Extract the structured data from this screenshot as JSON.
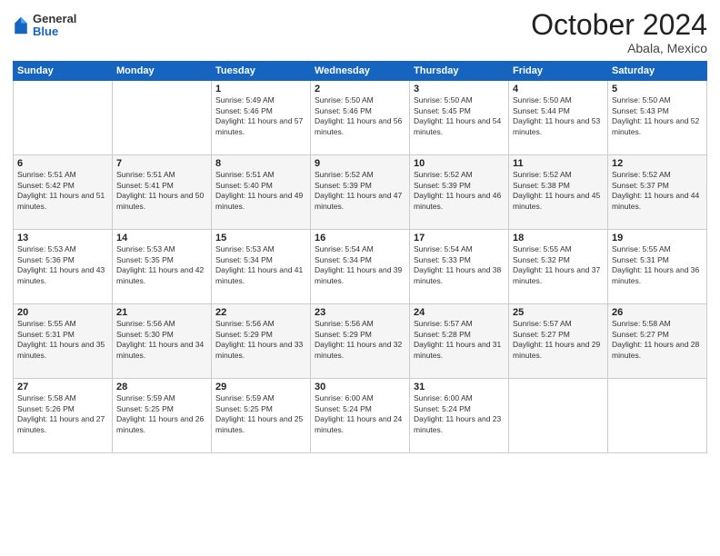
{
  "header": {
    "logo": {
      "general": "General",
      "blue": "Blue"
    },
    "title": "October 2024",
    "location": "Abala, Mexico"
  },
  "weekdays": [
    "Sunday",
    "Monday",
    "Tuesday",
    "Wednesday",
    "Thursday",
    "Friday",
    "Saturday"
  ],
  "weeks": [
    [
      {
        "day": null
      },
      {
        "day": null
      },
      {
        "day": "1",
        "sunrise": "5:49 AM",
        "sunset": "5:46 PM",
        "daylight": "11 hours and 57 minutes."
      },
      {
        "day": "2",
        "sunrise": "5:50 AM",
        "sunset": "5:46 PM",
        "daylight": "11 hours and 56 minutes."
      },
      {
        "day": "3",
        "sunrise": "5:50 AM",
        "sunset": "5:45 PM",
        "daylight": "11 hours and 54 minutes."
      },
      {
        "day": "4",
        "sunrise": "5:50 AM",
        "sunset": "5:44 PM",
        "daylight": "11 hours and 53 minutes."
      },
      {
        "day": "5",
        "sunrise": "5:50 AM",
        "sunset": "5:43 PM",
        "daylight": "11 hours and 52 minutes."
      }
    ],
    [
      {
        "day": "6",
        "sunrise": "5:51 AM",
        "sunset": "5:42 PM",
        "daylight": "11 hours and 51 minutes."
      },
      {
        "day": "7",
        "sunrise": "5:51 AM",
        "sunset": "5:41 PM",
        "daylight": "11 hours and 50 minutes."
      },
      {
        "day": "8",
        "sunrise": "5:51 AM",
        "sunset": "5:40 PM",
        "daylight": "11 hours and 49 minutes."
      },
      {
        "day": "9",
        "sunrise": "5:52 AM",
        "sunset": "5:39 PM",
        "daylight": "11 hours and 47 minutes."
      },
      {
        "day": "10",
        "sunrise": "5:52 AM",
        "sunset": "5:39 PM",
        "daylight": "11 hours and 46 minutes."
      },
      {
        "day": "11",
        "sunrise": "5:52 AM",
        "sunset": "5:38 PM",
        "daylight": "11 hours and 45 minutes."
      },
      {
        "day": "12",
        "sunrise": "5:52 AM",
        "sunset": "5:37 PM",
        "daylight": "11 hours and 44 minutes."
      }
    ],
    [
      {
        "day": "13",
        "sunrise": "5:53 AM",
        "sunset": "5:36 PM",
        "daylight": "11 hours and 43 minutes."
      },
      {
        "day": "14",
        "sunrise": "5:53 AM",
        "sunset": "5:35 PM",
        "daylight": "11 hours and 42 minutes."
      },
      {
        "day": "15",
        "sunrise": "5:53 AM",
        "sunset": "5:34 PM",
        "daylight": "11 hours and 41 minutes."
      },
      {
        "day": "16",
        "sunrise": "5:54 AM",
        "sunset": "5:34 PM",
        "daylight": "11 hours and 39 minutes."
      },
      {
        "day": "17",
        "sunrise": "5:54 AM",
        "sunset": "5:33 PM",
        "daylight": "11 hours and 38 minutes."
      },
      {
        "day": "18",
        "sunrise": "5:55 AM",
        "sunset": "5:32 PM",
        "daylight": "11 hours and 37 minutes."
      },
      {
        "day": "19",
        "sunrise": "5:55 AM",
        "sunset": "5:31 PM",
        "daylight": "11 hours and 36 minutes."
      }
    ],
    [
      {
        "day": "20",
        "sunrise": "5:55 AM",
        "sunset": "5:31 PM",
        "daylight": "11 hours and 35 minutes."
      },
      {
        "day": "21",
        "sunrise": "5:56 AM",
        "sunset": "5:30 PM",
        "daylight": "11 hours and 34 minutes."
      },
      {
        "day": "22",
        "sunrise": "5:56 AM",
        "sunset": "5:29 PM",
        "daylight": "11 hours and 33 minutes."
      },
      {
        "day": "23",
        "sunrise": "5:56 AM",
        "sunset": "5:29 PM",
        "daylight": "11 hours and 32 minutes."
      },
      {
        "day": "24",
        "sunrise": "5:57 AM",
        "sunset": "5:28 PM",
        "daylight": "11 hours and 31 minutes."
      },
      {
        "day": "25",
        "sunrise": "5:57 AM",
        "sunset": "5:27 PM",
        "daylight": "11 hours and 29 minutes."
      },
      {
        "day": "26",
        "sunrise": "5:58 AM",
        "sunset": "5:27 PM",
        "daylight": "11 hours and 28 minutes."
      }
    ],
    [
      {
        "day": "27",
        "sunrise": "5:58 AM",
        "sunset": "5:26 PM",
        "daylight": "11 hours and 27 minutes."
      },
      {
        "day": "28",
        "sunrise": "5:59 AM",
        "sunset": "5:25 PM",
        "daylight": "11 hours and 26 minutes."
      },
      {
        "day": "29",
        "sunrise": "5:59 AM",
        "sunset": "5:25 PM",
        "daylight": "11 hours and 25 minutes."
      },
      {
        "day": "30",
        "sunrise": "6:00 AM",
        "sunset": "5:24 PM",
        "daylight": "11 hours and 24 minutes."
      },
      {
        "day": "31",
        "sunrise": "6:00 AM",
        "sunset": "5:24 PM",
        "daylight": "11 hours and 23 minutes."
      },
      {
        "day": null
      },
      {
        "day": null
      }
    ]
  ]
}
